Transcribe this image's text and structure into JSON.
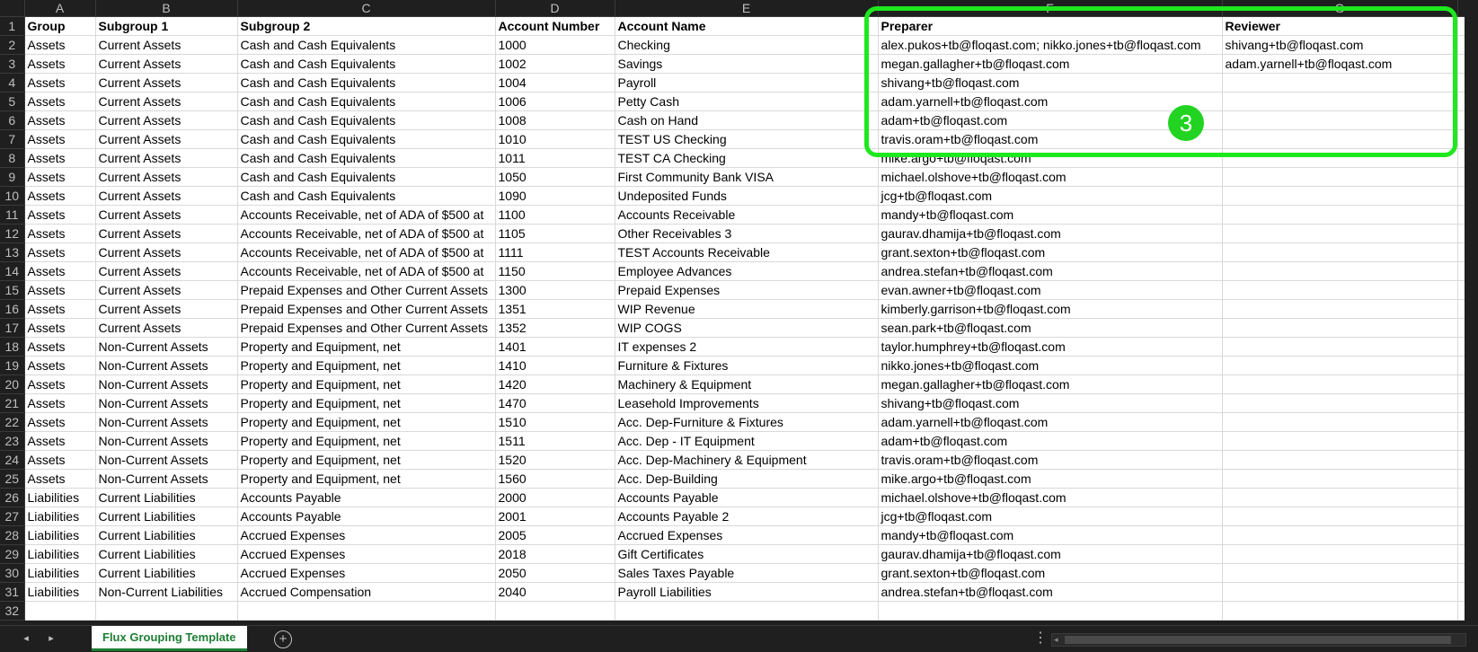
{
  "columns": [
    "A",
    "B",
    "C",
    "D",
    "E",
    "F",
    "G"
  ],
  "rows": [
    [
      "Group",
      "Subgroup 1",
      "Subgroup 2",
      "Account Number",
      "Account Name",
      "Preparer",
      "Reviewer"
    ],
    [
      "Assets",
      "Current Assets",
      "Cash and Cash Equivalents",
      "1000",
      "Checking",
      "alex.pukos+tb@floqast.com; nikko.jones+tb@floqast.com",
      "shivang+tb@floqast.com"
    ],
    [
      "Assets",
      "Current Assets",
      "Cash and Cash Equivalents",
      "1002",
      "Savings",
      "megan.gallagher+tb@floqast.com",
      "adam.yarnell+tb@floqast.com"
    ],
    [
      "Assets",
      "Current Assets",
      "Cash and Cash Equivalents",
      "1004",
      "Payroll",
      "shivang+tb@floqast.com",
      ""
    ],
    [
      "Assets",
      "Current Assets",
      "Cash and Cash Equivalents",
      "1006",
      "Petty Cash",
      "adam.yarnell+tb@floqast.com",
      ""
    ],
    [
      "Assets",
      "Current Assets",
      "Cash and Cash Equivalents",
      "1008",
      "Cash on Hand",
      "adam+tb@floqast.com",
      ""
    ],
    [
      "Assets",
      "Current Assets",
      "Cash and Cash Equivalents",
      "1010",
      "TEST US Checking",
      "travis.oram+tb@floqast.com",
      ""
    ],
    [
      "Assets",
      "Current Assets",
      "Cash and Cash Equivalents",
      "1011",
      "TEST CA Checking",
      "mike.argo+tb@floqast.com",
      ""
    ],
    [
      "Assets",
      "Current Assets",
      "Cash and Cash Equivalents",
      "1050",
      "First Community Bank VISA",
      "michael.olshove+tb@floqast.com",
      ""
    ],
    [
      "Assets",
      "Current Assets",
      "Cash and Cash Equivalents",
      "1090",
      "Undeposited Funds",
      "jcg+tb@floqast.com",
      ""
    ],
    [
      "Assets",
      "Current Assets",
      "Accounts Receivable, net of ADA of $500 at",
      "1100",
      "Accounts Receivable",
      "mandy+tb@floqast.com",
      ""
    ],
    [
      "Assets",
      "Current Assets",
      "Accounts Receivable, net of ADA of $500 at",
      "1105",
      "Other Receivables 3",
      "gaurav.dhamija+tb@floqast.com",
      ""
    ],
    [
      "Assets",
      "Current Assets",
      "Accounts Receivable, net of ADA of $500 at",
      "1111",
      "TEST Accounts Receivable",
      "grant.sexton+tb@floqast.com",
      ""
    ],
    [
      "Assets",
      "Current Assets",
      "Accounts Receivable, net of ADA of $500 at",
      "1150",
      "Employee Advances",
      "andrea.stefan+tb@floqast.com",
      ""
    ],
    [
      "Assets",
      "Current Assets",
      "Prepaid Expenses and Other Current Assets",
      "1300",
      "Prepaid Expenses",
      "evan.awner+tb@floqast.com",
      ""
    ],
    [
      "Assets",
      "Current Assets",
      "Prepaid Expenses and Other Current Assets",
      "1351",
      "WIP Revenue",
      "kimberly.garrison+tb@floqast.com",
      ""
    ],
    [
      "Assets",
      "Current Assets",
      "Prepaid Expenses and Other Current Assets",
      "1352",
      "WIP COGS",
      "sean.park+tb@floqast.com",
      ""
    ],
    [
      "Assets",
      "Non-Current Assets",
      "Property and Equipment, net",
      "1401",
      "IT expenses 2",
      "taylor.humphrey+tb@floqast.com",
      ""
    ],
    [
      "Assets",
      "Non-Current Assets",
      "Property and Equipment, net",
      "1410",
      "Furniture & Fixtures",
      "nikko.jones+tb@floqast.com",
      ""
    ],
    [
      "Assets",
      "Non-Current Assets",
      "Property and Equipment, net",
      "1420",
      "Machinery & Equipment",
      "megan.gallagher+tb@floqast.com",
      ""
    ],
    [
      "Assets",
      "Non-Current Assets",
      "Property and Equipment, net",
      "1470",
      "Leasehold Improvements",
      "shivang+tb@floqast.com",
      ""
    ],
    [
      "Assets",
      "Non-Current Assets",
      "Property and Equipment, net",
      "1510",
      "Acc. Dep-Furniture & Fixtures",
      "adam.yarnell+tb@floqast.com",
      ""
    ],
    [
      "Assets",
      "Non-Current Assets",
      "Property and Equipment, net",
      "1511",
      "Acc. Dep - IT Equipment",
      "adam+tb@floqast.com",
      ""
    ],
    [
      "Assets",
      "Non-Current Assets",
      "Property and Equipment, net",
      "1520",
      "Acc. Dep-Machinery & Equipment",
      "travis.oram+tb@floqast.com",
      ""
    ],
    [
      "Assets",
      "Non-Current Assets",
      "Property and Equipment, net",
      "1560",
      "Acc. Dep-Building",
      "mike.argo+tb@floqast.com",
      ""
    ],
    [
      "Liabilities",
      "Current Liabilities",
      "Accounts Payable",
      "2000",
      "Accounts Payable",
      "michael.olshove+tb@floqast.com",
      ""
    ],
    [
      "Liabilities",
      "Current Liabilities",
      "Accounts Payable",
      "2001",
      "Accounts Payable 2",
      "jcg+tb@floqast.com",
      ""
    ],
    [
      "Liabilities",
      "Current Liabilities",
      "Accrued Expenses",
      "2005",
      "Accrued Expenses",
      "mandy+tb@floqast.com",
      ""
    ],
    [
      "Liabilities",
      "Current Liabilities",
      "Accrued Expenses",
      "2018",
      "Gift Certificates",
      "gaurav.dhamija+tb@floqast.com",
      ""
    ],
    [
      "Liabilities",
      "Current Liabilities",
      "Accrued Expenses",
      "2050",
      "Sales Taxes Payable",
      "grant.sexton+tb@floqast.com",
      ""
    ],
    [
      "Liabilities",
      "Non-Current Liabilities",
      "Accrued Compensation",
      "2040",
      "Payroll Liabilities",
      "andrea.stefan+tb@floqast.com",
      ""
    ],
    [
      "",
      "",
      "",
      "",
      "",
      "",
      ""
    ]
  ],
  "annotation": {
    "badge_text": "3",
    "color": "#1ee81e"
  },
  "tabs": {
    "active_label": "Flux Grouping Template",
    "add_icon": "plus-circle-icon"
  },
  "colors": {
    "tab_accent": "#1e7e34",
    "background": "#1f1f1f"
  }
}
